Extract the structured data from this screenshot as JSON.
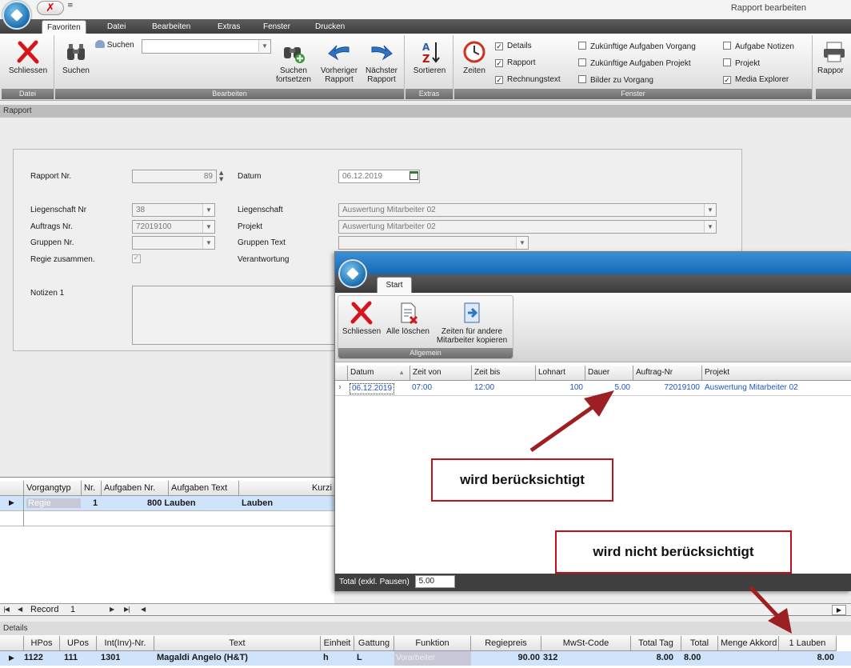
{
  "window": {
    "title": "Rapport bearbeiten",
    "qat_dropdown": "≡"
  },
  "ribbon": {
    "tabs": [
      "Favoriten",
      "Datei",
      "Bearbeiten",
      "Extras",
      "Fenster",
      "Drucken"
    ],
    "groups": {
      "datei": "Datei",
      "bearbeiten": "Bearbeiten",
      "extras": "Extras",
      "fenster": "Fenster"
    },
    "buttons": {
      "schliessen": "Schliessen",
      "suchen": "Suchen",
      "suchen_small": "Suchen",
      "suchen_fortsetzen_1": "Suchen",
      "suchen_fortsetzen_2": "fortsetzen",
      "vorheriger_1": "Vorheriger",
      "vorheriger_2": "Rapport",
      "naechster_1": "Nächster",
      "naechster_2": "Rapport",
      "sortieren": "Sortieren",
      "zeiten": "Zeiten",
      "rapport_print": "Rappor"
    },
    "search_value": "",
    "checkboxes": [
      {
        "label": "Details",
        "checked": true
      },
      {
        "label": "Rapport",
        "checked": true
      },
      {
        "label": "Rechnungstext",
        "checked": true
      },
      {
        "label": "Zukünftige Aufgaben Vorgang",
        "checked": false
      },
      {
        "label": "Zukünftige Aufgaben Projekt",
        "checked": false
      },
      {
        "label": "Bilder zu Vorgang",
        "checked": false
      },
      {
        "label": "Aufgabe Notizen",
        "checked": false
      },
      {
        "label": "Projekt",
        "checked": false
      },
      {
        "label": "Media Explorer",
        "checked": true
      }
    ]
  },
  "rapport_section": "Rapport",
  "form": {
    "rapport_nr_label": "Rapport Nr.",
    "rapport_nr": "89",
    "datum_label": "Datum",
    "datum": "06.12.2019",
    "liegenschaft_nr_label": "Liegenschaft Nr",
    "liegenschaft_nr": "38",
    "auftrags_nr_label": "Auftrags Nr.",
    "auftrags_nr": "72019100",
    "gruppen_nr_label": "Gruppen Nr.",
    "gruppen_nr": "",
    "regie_label": "Regie zusammen.",
    "liegenschaft_label": "Liegenschaft",
    "liegenschaft": "Auswertung Mitarbeiter 02",
    "projekt_label": "Projekt",
    "projekt": "Auswertung Mitarbeiter 02",
    "gruppen_text_label": "Gruppen Text",
    "gruppen_text": "",
    "verantwortung_label": "Verantwortung",
    "notizen_label": "Notizen 1"
  },
  "vorgang_grid": {
    "headers": [
      "Vorgangtyp",
      "Nr.",
      "Aufgaben Nr.",
      "Aufgaben Text",
      "Kurzi"
    ],
    "row": {
      "vorgangtyp": "Regie",
      "nr": "1",
      "aufgaben_nr": "800",
      "aufgaben_nr_text": "Lauben",
      "aufgaben_text": "Lauben"
    }
  },
  "navigator": {
    "label": "Record",
    "value": "1"
  },
  "details_section": "Details",
  "details_grid": {
    "headers": [
      "HPos",
      "UPos",
      "Int(Inv)-Nr.",
      "Text",
      "Einheit",
      "Gattung",
      "Funktion",
      "Regiepreis",
      "MwSt-Code",
      "Total Tag",
      "Total",
      "Menge Akkord",
      "1 Lauben"
    ],
    "row": {
      "hpos": "1122",
      "upos": "111",
      "int_nr": "1301",
      "text": "Magaldi Angelo (H&T)",
      "einheit": "h",
      "gattung": "L",
      "funktion": "Vorarbeiter",
      "regiepreis": "90.00",
      "mwst": "312",
      "total_tag": "8.00",
      "total": "8.00",
      "lauben": "8.00"
    }
  },
  "popup": {
    "tab": "Start",
    "group_label": "Allgemein",
    "buttons": {
      "schliessen": "Schliessen",
      "alle_loeschen": "Alle löschen",
      "kopieren_1": "Zeiten für andere",
      "kopieren_2": "Mitarbeiter kopieren"
    },
    "grid": {
      "headers": [
        "Datum",
        "Zeit von",
        "Zeit bis",
        "Lohnart",
        "Dauer",
        "Auftrag-Nr",
        "Projekt"
      ],
      "row": {
        "datum": "06.12.2019",
        "zeit_von": "07:00",
        "zeit_bis": "12:00",
        "lohnart": "100",
        "dauer": "5.00",
        "auftrag_nr": "72019100",
        "projekt": "Auswertung Mitarbeiter 02"
      }
    },
    "total_label": "Total (exkl. Pausen)",
    "total_value": "5.00"
  },
  "annotations": {
    "considered": "wird berücksichtigt",
    "not_considered": "wird nicht berücksichtigt"
  },
  "colors": {
    "accent_blue": "#1f55c7",
    "selection": "#cfe3fb",
    "callout_red": "#c0111a",
    "arrow_red": "#9c1f22"
  }
}
